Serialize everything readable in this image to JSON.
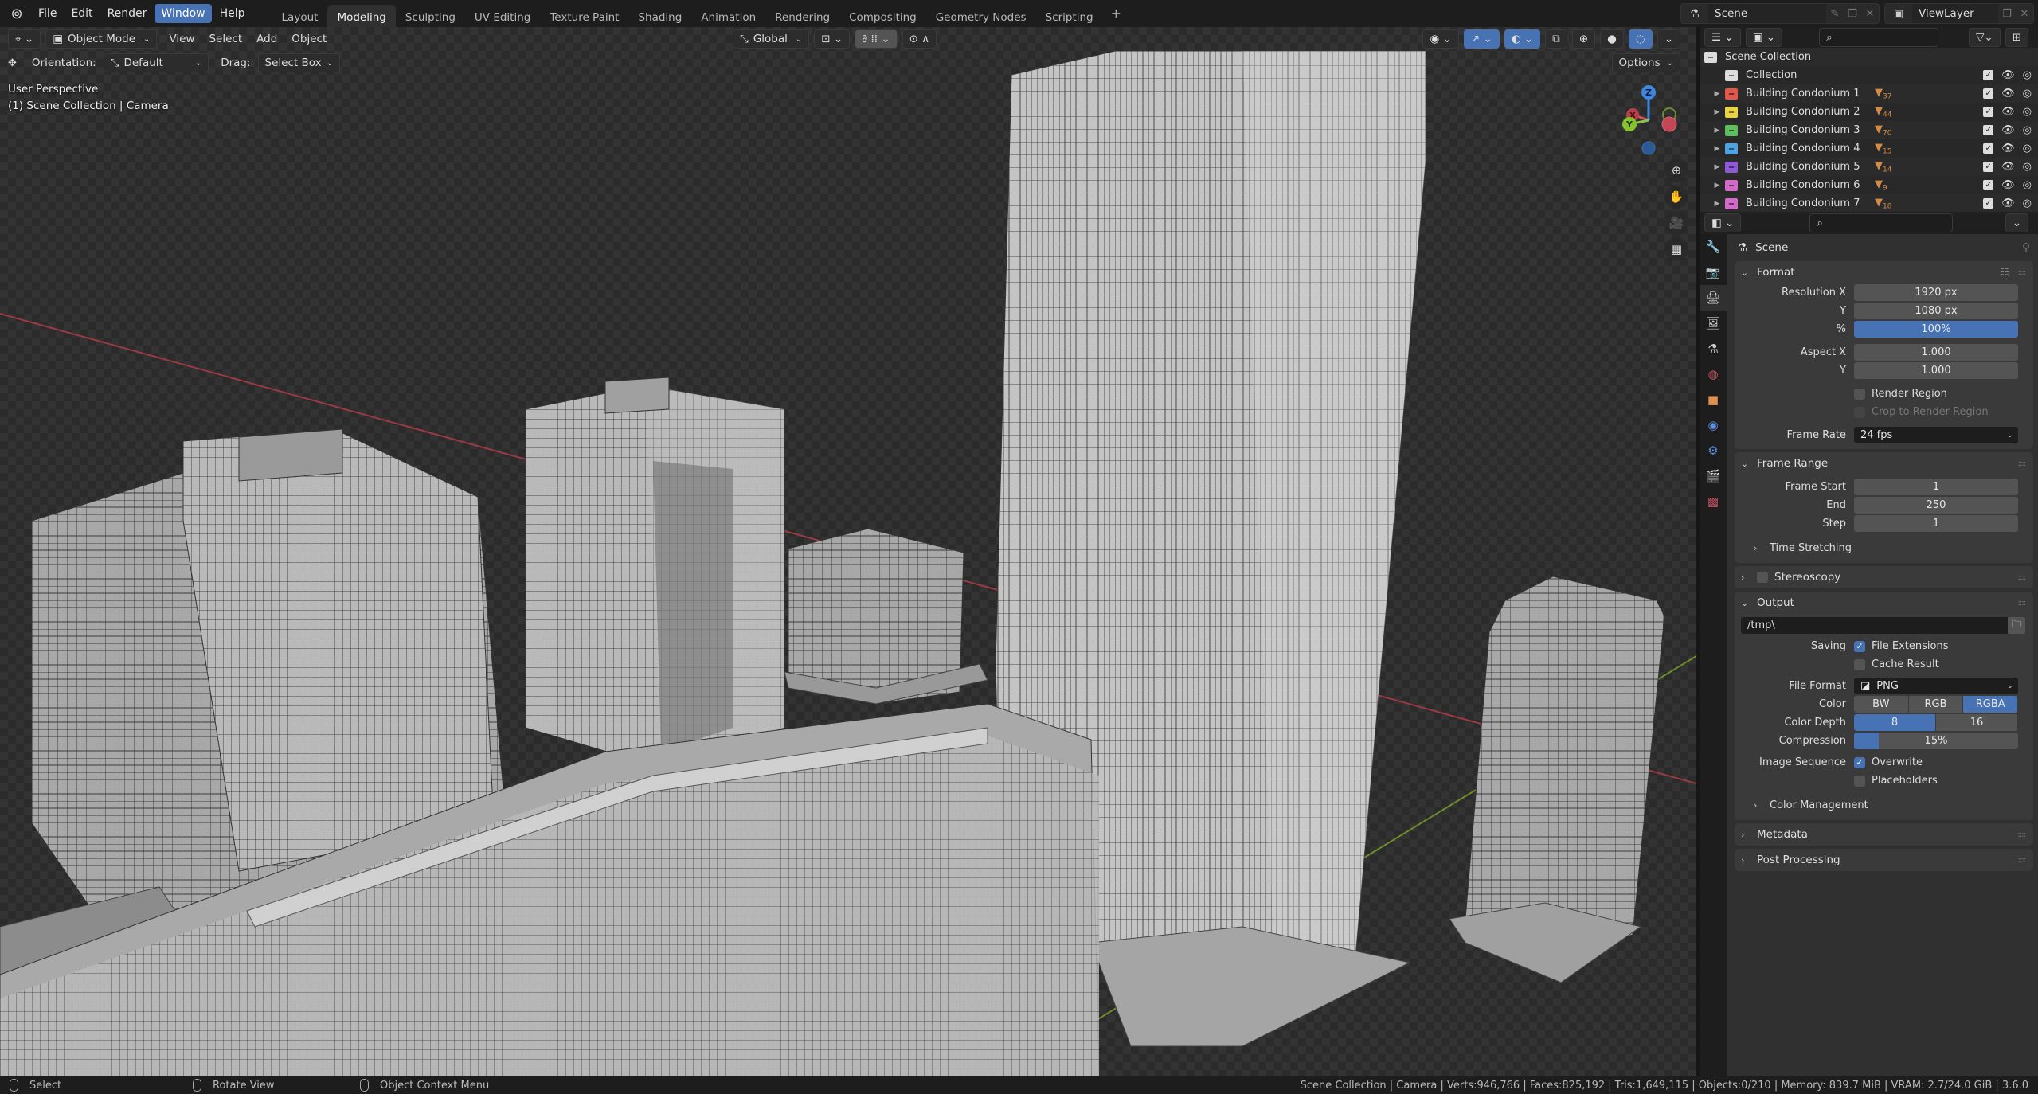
{
  "menubar": {
    "items": [
      "File",
      "Edit",
      "Render",
      "Window",
      "Help"
    ],
    "active": "Window"
  },
  "workspaces": {
    "tabs": [
      "Layout",
      "Modeling",
      "Sculpting",
      "UV Editing",
      "Texture Paint",
      "Shading",
      "Animation",
      "Rendering",
      "Compositing",
      "Geometry Nodes",
      "Scripting"
    ],
    "active": "Modeling",
    "add_label": "+"
  },
  "scene_selector": {
    "value": "Scene"
  },
  "viewlayer_selector": {
    "value": "ViewLayer"
  },
  "viewport": {
    "mode": "Object Mode",
    "menus": [
      "View",
      "Select",
      "Add",
      "Object"
    ],
    "orientation_label": "Orientation:",
    "orientation_value": "Default",
    "drag_label": "Drag:",
    "drag_value": "Select Box",
    "transform_orientation": "Global",
    "options_label": "Options",
    "overlay_line1": "User Perspective",
    "overlay_line2": "(1) Scene Collection | Camera",
    "gizmo_axes": {
      "x": "X",
      "y": "Y",
      "z": "Z"
    }
  },
  "outliner": {
    "root": "Scene Collection",
    "items": [
      {
        "name": "Collection",
        "color": "#dddddd",
        "badge": "",
        "expandable": false
      },
      {
        "name": "Building Condonium 1",
        "color": "#e2574c",
        "badge": "37",
        "expandable": true
      },
      {
        "name": "Building Condonium 2",
        "color": "#e8d24a",
        "badge": "44",
        "expandable": true
      },
      {
        "name": "Building Condonium 3",
        "color": "#5dbf5d",
        "badge": "70",
        "expandable": true
      },
      {
        "name": "Building Condonium 4",
        "color": "#4fa3e0",
        "badge": "15",
        "expandable": true
      },
      {
        "name": "Building Condonium 5",
        "color": "#8d5ad6",
        "badge": "14",
        "expandable": true
      },
      {
        "name": "Building Condonium 6",
        "color": "#d26bc7",
        "badge": "9",
        "expandable": true
      },
      {
        "name": "Building Condonium 7",
        "color": "#d26bc7",
        "badge": "18",
        "expandable": true
      }
    ]
  },
  "properties": {
    "context": "Scene",
    "format": {
      "title": "Format",
      "resolution_x_label": "Resolution X",
      "resolution_x": "1920 px",
      "resolution_y_label": "Y",
      "resolution_y": "1080 px",
      "percent_label": "%",
      "percent": "100%",
      "aspect_x_label": "Aspect X",
      "aspect_x": "1.000",
      "aspect_y_label": "Y",
      "aspect_y": "1.000",
      "render_region": "Render Region",
      "crop_region": "Crop to Render Region",
      "frame_rate_label": "Frame Rate",
      "frame_rate": "24 fps"
    },
    "frame_range": {
      "title": "Frame Range",
      "start_label": "Frame Start",
      "start": "1",
      "end_label": "End",
      "end": "250",
      "step_label": "Step",
      "step": "1",
      "time_stretching": "Time Stretching"
    },
    "stereoscopy": {
      "title": "Stereoscopy"
    },
    "output": {
      "title": "Output",
      "path": "/tmp\\",
      "saving_label": "Saving",
      "file_extensions": "File Extensions",
      "cache_result": "Cache Result",
      "file_format_label": "File Format",
      "file_format": "PNG",
      "color_label": "Color",
      "color_options": [
        "BW",
        "RGB",
        "RGBA"
      ],
      "color_selected": "RGBA",
      "color_depth_label": "Color Depth",
      "color_depth_options": [
        "8",
        "16"
      ],
      "color_depth_selected": "8",
      "compression_label": "Compression",
      "compression": "15%",
      "compression_fraction": 0.15,
      "image_sequence_label": "Image Sequence",
      "overwrite": "Overwrite",
      "placeholders": "Placeholders",
      "color_management": "Color Management"
    },
    "metadata": {
      "title": "Metadata"
    },
    "post_processing": {
      "title": "Post Processing"
    }
  },
  "statusbar": {
    "hints": [
      "Select",
      "Rotate View",
      "Object Context Menu"
    ],
    "stats": "Scene Collection | Camera | Verts:946,766 | Faces:825,192 | Tris:1,649,115 | Objects:0/210 | Memory: 839.7 MiB | VRAM: 2.7/24.0 GiB | 3.6.0"
  }
}
